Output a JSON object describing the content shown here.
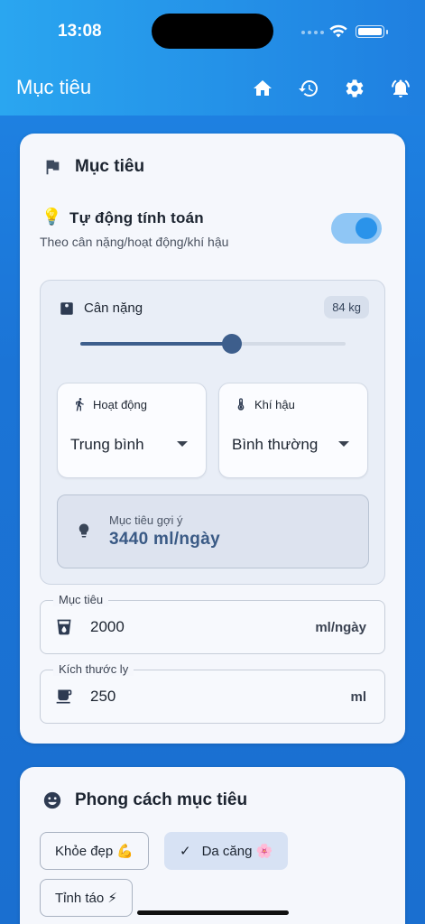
{
  "status_bar": {
    "time": "13:08"
  },
  "app_bar": {
    "title": "Mục tiêu",
    "icons": [
      "home-icon",
      "history-icon",
      "settings-icon",
      "notification-icon"
    ]
  },
  "goal_card": {
    "title": "Mục tiêu",
    "auto_calc": {
      "icon": "💡",
      "title": "Tự động tính toán",
      "subtitle": "Theo cân nặng/hoạt động/khí hậu",
      "enabled": true
    },
    "weight": {
      "label": "Cân nặng",
      "value_text": "84 kg",
      "slider_fraction": 0.57
    },
    "activity": {
      "label": "Hoạt động",
      "value": "Trung bình"
    },
    "climate": {
      "label": "Khí hậu",
      "value": "Bình thường"
    },
    "suggestion": {
      "label": "Mục tiêu gợi ý",
      "value": "3440 ml/ngày"
    },
    "goal_field": {
      "label": "Mục tiêu",
      "value": "2000",
      "suffix": "ml/ngày"
    },
    "cup_field": {
      "label": "Kích thước ly",
      "value": "250",
      "suffix": "ml"
    }
  },
  "style_card": {
    "title": "Phong cách mục tiêu",
    "chips": [
      {
        "label": "Khỏe đẹp 💪",
        "selected": false
      },
      {
        "label": "Da căng 🌸",
        "selected": true
      },
      {
        "label": "Tỉnh táo ⚡",
        "selected": false
      }
    ],
    "check_glyph": "✓"
  },
  "colors": {
    "primary": "#1f7fe0",
    "accent_dark": "#3d5e8c",
    "toggle_track": "#8fc6f5",
    "toggle_knob": "#2a93ea",
    "card_bg": "#f5f7fc"
  }
}
